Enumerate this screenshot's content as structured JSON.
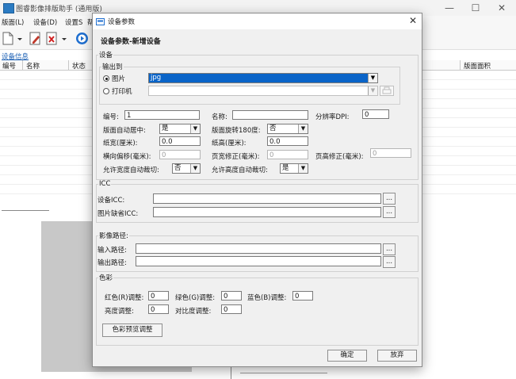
{
  "app": {
    "title": "图睿影像排版助手 (通用版)",
    "menu": [
      "版面(L)",
      "设备(D)",
      "设置S",
      "帮"
    ],
    "window_controls": {
      "minimize": "—",
      "maximize": "☐",
      "close": "✕"
    }
  },
  "panel": {
    "title": "设备信息",
    "columns": [
      "编号",
      "名称",
      "状态"
    ],
    "right_column": "版面面积"
  },
  "dialog": {
    "title": "设备参数",
    "close": "✕",
    "heading": "设备参数-新增设备",
    "device_group": "设备",
    "output_group": "输出到",
    "output_options": [
      {
        "label": "图片",
        "selected": true,
        "value": "jpg"
      },
      {
        "label": "打印机",
        "selected": false,
        "value": ""
      }
    ],
    "fields": {
      "number_label": "编号:",
      "number_value": "1",
      "name_label": "名称:",
      "name_value": "",
      "dpi_label": "分辨率DPI:",
      "dpi_value": "0",
      "auto_center_label": "版面自动居中:",
      "auto_center_value": "是",
      "rotate_label": "版面旋转180度:",
      "rotate_value": "否",
      "paper_width_label": "纸宽(厘米):",
      "paper_width_value": "0.0",
      "paper_height_label": "纸高(厘米):",
      "paper_height_value": "0.0",
      "h_offset_label": "横向偏移(毫米):",
      "h_offset_value": "0",
      "w_correction_label": "页宽修正(毫米):",
      "w_correction_value": "0",
      "h_correction_label": "页高修正(毫米):",
      "h_correction_value": "0",
      "auto_cut_w_label": "允许宽度自动裁切:",
      "auto_cut_w_value": "否",
      "auto_cut_h_label": "允许高度自动裁切:",
      "auto_cut_h_value": "是"
    },
    "icc": {
      "group": "ICC",
      "device_label": "设备ICC:",
      "device_value": "",
      "image_label": "图片缺省ICC:",
      "image_value": "",
      "browse": "..."
    },
    "paths": {
      "group": "影像路径:",
      "input_label": "输入路径:",
      "input_value": "",
      "output_label": "输出路径:",
      "output_value": "",
      "browse": "..."
    },
    "color": {
      "group": "色彩",
      "red_label": "红色(R)调整:",
      "red_value": "0",
      "green_label": "绿色(G)调整:",
      "green_value": "0",
      "blue_label": "蓝色(B)调整:",
      "blue_value": "0",
      "brightness_label": "亮度调整:",
      "brightness_value": "0",
      "contrast_label": "对比度调整:",
      "contrast_value": "0",
      "preview_button": "色彩预览调整"
    },
    "ok_button": "确定",
    "cancel_button": "放弃"
  },
  "colors": {
    "accent": "#0a64c8",
    "selection": "#0a64c8",
    "dialog_bg": "#f0f0f0"
  }
}
